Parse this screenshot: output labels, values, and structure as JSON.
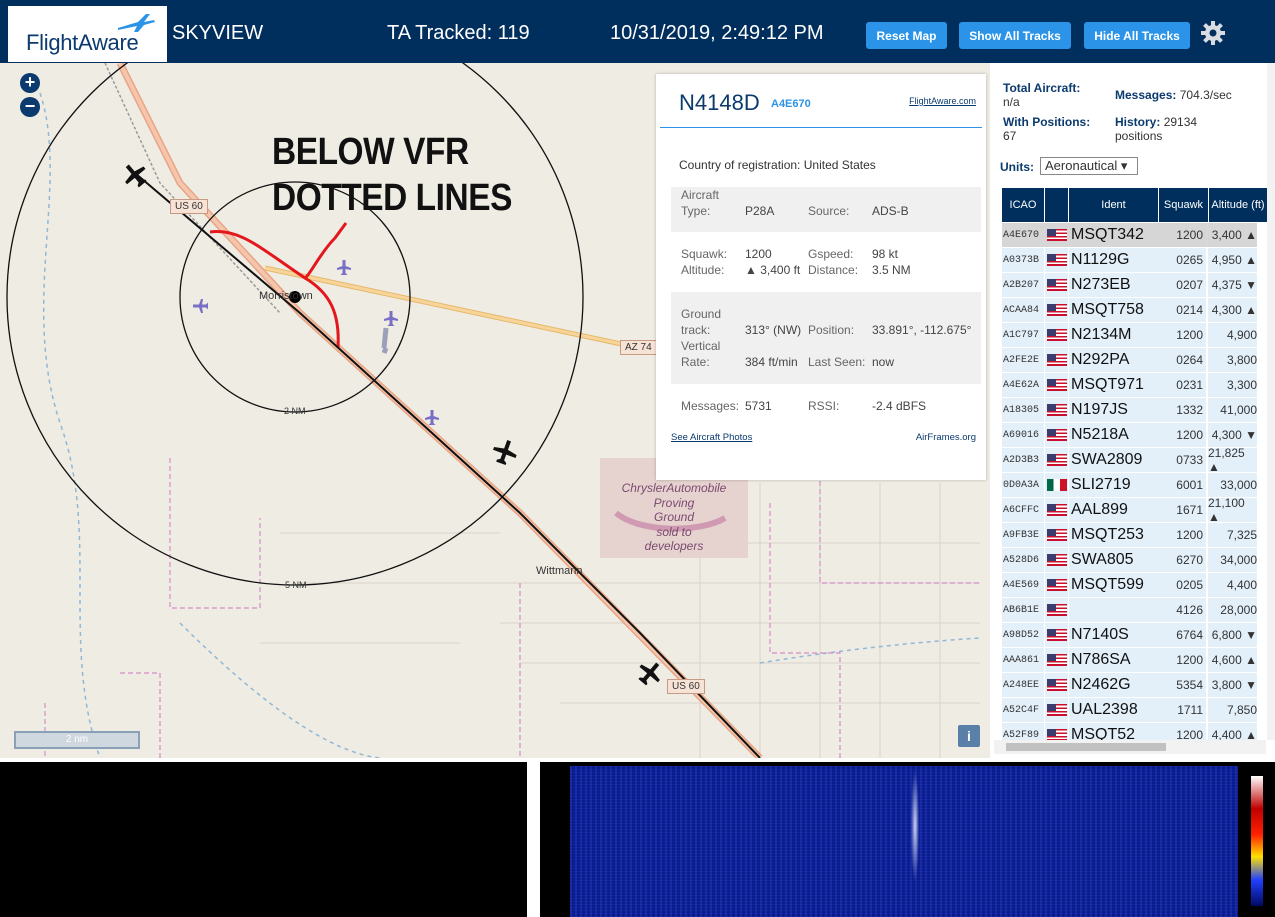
{
  "header": {
    "logo_text": "FlightAware",
    "app_name": "SKYVIEW",
    "ta_tracked": "TA Tracked: 119",
    "datetime": "10/31/2019, 2:49:12 PM",
    "reset_map": "Reset Map",
    "show_all_tracks": "Show All Tracks",
    "hide_all_tracks": "Hide All Tracks",
    "settings_icon": "gear-icon"
  },
  "map": {
    "zoom_in": "+",
    "zoom_out": "−",
    "annotation": [
      "BELOW VFR",
      "DOTTED LINES"
    ],
    "labels": {
      "us60_top": "US 60",
      "us60_bottom": "US 60",
      "az74": "AZ 74",
      "morristown": "Morristown",
      "wittmann": "Wittmann",
      "ring_2nm": "2 NM",
      "ring_5nm": "5 NM",
      "proving_ground": [
        "ChryslerAutomobile",
        "Proving",
        "Ground",
        "sold to",
        "developers"
      ]
    },
    "scale": "2 nm",
    "info": "i"
  },
  "popup": {
    "registration": "N4148D",
    "icao": "A4E670",
    "fa_link": "FlightAware.com",
    "country_label": "Country of registration:",
    "country_value": "United States",
    "aircraft_type_label": [
      "Aircraft",
      "Type:"
    ],
    "aircraft_type": "P28A",
    "source_label": "Source:",
    "source": "ADS-B",
    "squawk_label": "Squawk:",
    "squawk": "1200",
    "gspeed_label": "Gspeed:",
    "gspeed": "98 kt",
    "altitude_label": "Altitude:",
    "altitude": "▲ 3,400 ft",
    "distance_label": "Distance:",
    "distance": "3.5 NM",
    "ground_track_label": [
      "Ground",
      "track:"
    ],
    "ground_track": "313° (NW)",
    "position_label": "Position:",
    "position": "33.891°, -112.675°",
    "vrate_label": [
      "Vertical",
      "Rate:"
    ],
    "vrate": "384 ft/min",
    "last_seen_label": "Last Seen:",
    "last_seen": "now",
    "messages_label": "Messages:",
    "messages": "5731",
    "rssi_label": "RSSI:",
    "rssi": "-2.4 dBFS",
    "photos_link": "See Aircraft Photos",
    "airframes_link": "AirFrames.org"
  },
  "panel": {
    "total_aircraft_label": "Total Aircraft:",
    "total_aircraft": "n/a",
    "with_positions_label": "With Positions:",
    "with_positions": "67",
    "messages_label": "Messages:",
    "messages": "704.3/sec",
    "history_label": "History:",
    "history": "29134",
    "history_unit": "positions",
    "units_label": "Units:",
    "units_value": "Aeronautical ▾",
    "columns": [
      "ICAO",
      "Ident",
      "Squawk",
      "Altitude (ft)"
    ],
    "rows": [
      {
        "icao": "A4E670",
        "flag": "us",
        "ident": "MSQT342",
        "squawk": "1200",
        "alt": "3,400 ▲"
      },
      {
        "icao": "A0373B",
        "flag": "us",
        "ident": "N1129G",
        "squawk": "0265",
        "alt": "4,950 ▲"
      },
      {
        "icao": "A2B207",
        "flag": "us",
        "ident": "N273EB",
        "squawk": "0207",
        "alt": "4,375 ▼"
      },
      {
        "icao": "ACAA84",
        "flag": "us",
        "ident": "MSQT758",
        "squawk": "0214",
        "alt": "4,300 ▲"
      },
      {
        "icao": "A1C797",
        "flag": "us",
        "ident": "N2134M",
        "squawk": "1200",
        "alt": "4,900"
      },
      {
        "icao": "A2FE2E",
        "flag": "us",
        "ident": "N292PA",
        "squawk": "0264",
        "alt": "3,800"
      },
      {
        "icao": "A4E62A",
        "flag": "us",
        "ident": "MSQT971",
        "squawk": "0231",
        "alt": "3,300"
      },
      {
        "icao": "A18305",
        "flag": "us",
        "ident": "N197JS",
        "squawk": "1332",
        "alt": "41,000"
      },
      {
        "icao": "A69016",
        "flag": "us",
        "ident": "N5218A",
        "squawk": "1200",
        "alt": "4,300 ▼"
      },
      {
        "icao": "A2D3B3",
        "flag": "us",
        "ident": "SWA2809",
        "squawk": "0733",
        "alt": "21,825 ▲"
      },
      {
        "icao": "0D0A3A",
        "flag": "mx",
        "ident": "SLI2719",
        "squawk": "6001",
        "alt": "33,000"
      },
      {
        "icao": "A6CFFC",
        "flag": "us",
        "ident": "AAL899",
        "squawk": "1671",
        "alt": "21,100 ▲"
      },
      {
        "icao": "A9FB3E",
        "flag": "us",
        "ident": "MSQT253",
        "squawk": "1200",
        "alt": "7,325"
      },
      {
        "icao": "A528D6",
        "flag": "us",
        "ident": "SWA805",
        "squawk": "6270",
        "alt": "34,000"
      },
      {
        "icao": "A4E569",
        "flag": "us",
        "ident": "MSQT599",
        "squawk": "0205",
        "alt": "4,400"
      },
      {
        "icao": "AB6B1E",
        "flag": "us",
        "ident": "",
        "squawk": "4126",
        "alt": "28,000"
      },
      {
        "icao": "A98D52",
        "flag": "us",
        "ident": "N7140S",
        "squawk": "6764",
        "alt": "6,800 ▼"
      },
      {
        "icao": "AAA861",
        "flag": "us",
        "ident": "N786SA",
        "squawk": "1200",
        "alt": "4,600 ▲"
      },
      {
        "icao": "A248EE",
        "flag": "us",
        "ident": "N2462G",
        "squawk": "5354",
        "alt": "3,800 ▼"
      },
      {
        "icao": "A52C4F",
        "flag": "us",
        "ident": "UAL2398",
        "squawk": "1711",
        "alt": "7,850"
      },
      {
        "icao": "A52F89",
        "flag": "us",
        "ident": "MSQT52",
        "squawk": "1200",
        "alt": "4,400 ▲"
      }
    ]
  }
}
